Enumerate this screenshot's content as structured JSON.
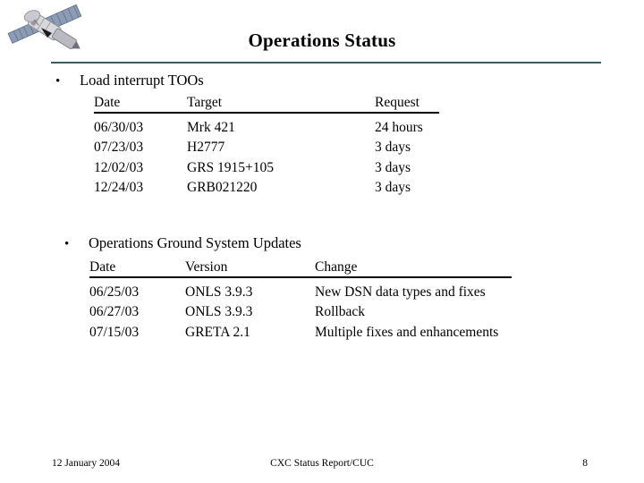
{
  "slide": {
    "title": "Operations Status",
    "logo_icon": "satellite-icon",
    "accent_color": "#3d5a63",
    "background_color": "#ffffff"
  },
  "bullets": [
    {
      "marker": "•",
      "text": "Load interrupt TOOs"
    },
    {
      "marker": "•",
      "text": "Operations Ground System Updates"
    }
  ],
  "tables": {
    "toos": {
      "headers": [
        "Date",
        "Target",
        "Request"
      ],
      "rows": [
        [
          "06/30/03",
          "Mrk 421",
          "24 hours"
        ],
        [
          "07/23/03",
          "H2777",
          "3 days"
        ],
        [
          "12/02/03",
          "GRS 1915+105",
          "3 days"
        ],
        [
          "12/24/03",
          "GRB021220",
          "3 days"
        ]
      ]
    },
    "updates": {
      "headers": [
        "Date",
        "Version",
        "Change"
      ],
      "rows": [
        [
          "06/25/03",
          "ONLS 3.9.3",
          "New DSN data types and fixes"
        ],
        [
          "06/27/03",
          "ONLS 3.9.3",
          "Rollback"
        ],
        [
          "07/15/03",
          "GRETA 2.1",
          "Multiple fixes and enhancements"
        ]
      ]
    }
  },
  "footer": {
    "date": "12 January 2004",
    "center": "CXC Status Report/CUC",
    "page": "8"
  }
}
